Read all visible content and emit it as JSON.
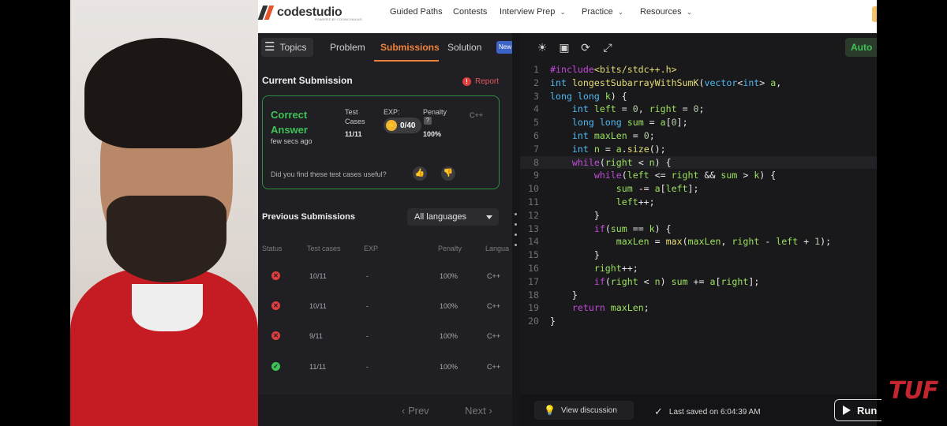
{
  "nav": {
    "logo_text": "codestudio",
    "logo_sub": "POWERED BY CODING NINJAS",
    "items": [
      "Guided Paths",
      "Contests",
      "Interview Prep",
      "Practice",
      "Resources"
    ]
  },
  "tabs": {
    "topics": "Topics",
    "problem": "Problem",
    "submissions": "Submissions",
    "solution": "Solution",
    "new_badge": "New"
  },
  "current": {
    "title": "Current Submission",
    "report": "Report",
    "verdict": "Correct Answer",
    "time": "few secs ago",
    "test_cases_label": "Test Cases",
    "test_cases_value": "11/11",
    "exp_label": "EXP:",
    "exp_value": "0/40",
    "penalty_label": "Penalty",
    "penalty_value": "100%",
    "language": "C++",
    "helpful": "Did you find these test cases useful?"
  },
  "previous": {
    "title": "Previous Submissions",
    "filter": "All languages",
    "headers": [
      "Status",
      "Test cases",
      "EXP",
      "Penalty",
      "Langua"
    ],
    "rows": [
      {
        "status": "fail",
        "tests": "10/11",
        "exp": "-",
        "penalty": "100%",
        "lang": "C++"
      },
      {
        "status": "fail",
        "tests": "10/11",
        "exp": "-",
        "penalty": "100%",
        "lang": "C++"
      },
      {
        "status": "fail",
        "tests": "9/11",
        "exp": "-",
        "penalty": "100%",
        "lang": "C++"
      },
      {
        "status": "pass",
        "tests": "11/11",
        "exp": "-",
        "penalty": "100%",
        "lang": "C++"
      }
    ],
    "prev": "Prev",
    "next": "Next"
  },
  "editor": {
    "auto": "Auto",
    "icons": [
      "sun-icon",
      "save-icon",
      "refresh-icon",
      "fullscreen-icon"
    ],
    "code_lines": [
      "#include<bits/stdc++.h>",
      "int longestSubarrayWithSumK(vector<int> a,",
      "long long k) {",
      "    int left = 0, right = 0;",
      "    long long sum = a[0];",
      "    int maxLen = 0;",
      "    int n = a.size();",
      "    while(right < n) {",
      "        while(left <= right && sum > k) {",
      "            sum -= a[left];",
      "            left++;",
      "        }",
      "        if(sum == k) {",
      "            maxLen = max(maxLen, right - left + 1);",
      "        }",
      "        right++;",
      "        if(right < n) sum += a[right];",
      "    }",
      "    return maxLen;",
      "}"
    ],
    "line_numbers": [
      "1",
      "2",
      "",
      "3",
      "4",
      "5",
      "6",
      "7",
      "8",
      "9",
      "10",
      "11",
      "12",
      "13",
      "14",
      "15",
      "16",
      "17",
      "18",
      "19",
      "20"
    ],
    "view_discussion": "View discussion",
    "saved": "Last saved on 6:04:39 AM",
    "run": "Run"
  },
  "watermark": "TUF"
}
